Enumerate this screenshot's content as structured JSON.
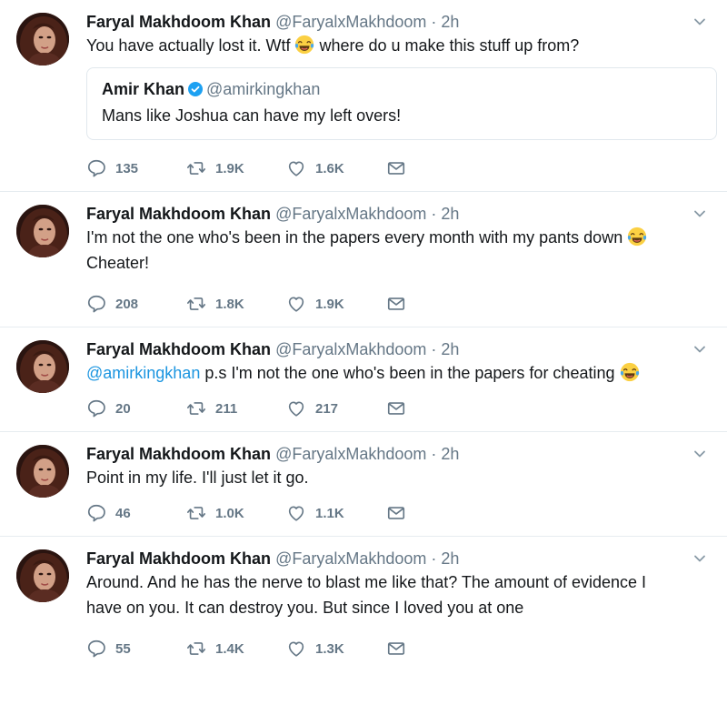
{
  "tweets": [
    {
      "name": "Faryal Makhdoom Khan",
      "handle": "@FaryalxMakhdoom",
      "time": "2h",
      "text_before_emoji": "You have actually lost it. Wtf ",
      "text_after_emoji": " where do u make this stuff up from?",
      "quote": {
        "name": "Amir Khan",
        "handle": "@amirkingkhan",
        "text": "Mans like Joshua can have my left overs!"
      },
      "replies": "135",
      "retweets": "1.9K",
      "likes": "1.6K"
    },
    {
      "name": "Faryal Makhdoom Khan",
      "handle": "@FaryalxMakhdoom",
      "time": "2h",
      "text_line1": "I'm not the one who's been in the papers every month with my pants down ",
      "text_line2": "Cheater!",
      "replies": "208",
      "retweets": "1.8K",
      "likes": "1.9K"
    },
    {
      "name": "Faryal Makhdoom Khan",
      "handle": "@FaryalxMakhdoom",
      "time": "2h",
      "mention": "@amirkingkhan",
      "text": " p.s I'm not the one who's been in the papers for cheating ",
      "replies": "20",
      "retweets": "211",
      "likes": "217"
    },
    {
      "name": "Faryal Makhdoom Khan",
      "handle": "@FaryalxMakhdoom",
      "time": "2h",
      "text": "Point in my life. I'll just let it go.",
      "replies": "46",
      "retweets": "1.0K",
      "likes": "1.1K"
    },
    {
      "name": "Faryal Makhdoom Khan",
      "handle": "@FaryalxMakhdoom",
      "time": "2h",
      "text_line1": "Around. And he has the nerve to blast me like that? The amount of evidence I",
      "text_line2": "have on you. It can destroy you. But since I loved you at one",
      "replies": "55",
      "retweets": "1.4K",
      "likes": "1.3K"
    }
  ],
  "separator": "·",
  "icons": {
    "reply": "reply-icon",
    "retweet": "retweet-icon",
    "like": "heart-icon",
    "dm": "envelope-icon",
    "caret": "chevron-down-icon",
    "emoji": "face-with-tears-of-joy-icon",
    "verified": "verified-badge-icon"
  },
  "colors": {
    "link": "#1b95e0",
    "muted": "#657786",
    "text": "#14171a",
    "border": "#e6ecf0",
    "verified": "#1da1f2"
  }
}
